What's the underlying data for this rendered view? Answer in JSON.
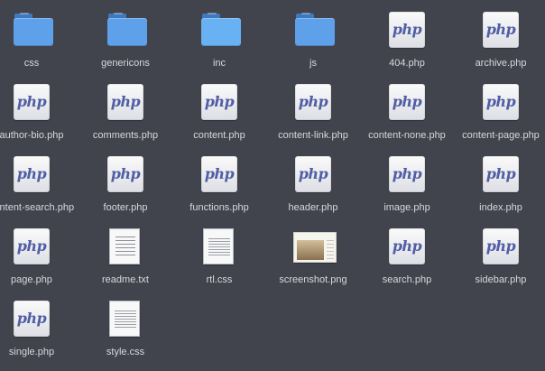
{
  "file_view": {
    "files": [
      {
        "name": "css",
        "kind": "folder",
        "icon": "folder-icon"
      },
      {
        "name": "genericons",
        "kind": "folder",
        "icon": "folder-icon"
      },
      {
        "name": "inc",
        "kind": "folder",
        "icon": "folder-icon"
      },
      {
        "name": "js",
        "kind": "folder",
        "icon": "folder-icon"
      },
      {
        "name": "404.php",
        "kind": "php",
        "icon": "php-file-icon"
      },
      {
        "name": "archive.php",
        "kind": "php",
        "icon": "php-file-icon"
      },
      {
        "name": "author-bio.php",
        "kind": "php",
        "icon": "php-file-icon"
      },
      {
        "name": "comments.php",
        "kind": "php",
        "icon": "php-file-icon"
      },
      {
        "name": "content.php",
        "kind": "php",
        "icon": "php-file-icon"
      },
      {
        "name": "content-link.php",
        "kind": "php",
        "icon": "php-file-icon"
      },
      {
        "name": "content-none.php",
        "kind": "php",
        "icon": "php-file-icon"
      },
      {
        "name": "content-page.php",
        "kind": "php",
        "icon": "php-file-icon"
      },
      {
        "name": "content-search.php",
        "kind": "php",
        "icon": "php-file-icon"
      },
      {
        "name": "footer.php",
        "kind": "php",
        "icon": "php-file-icon"
      },
      {
        "name": "functions.php",
        "kind": "php",
        "icon": "php-file-icon"
      },
      {
        "name": "header.php",
        "kind": "php",
        "icon": "php-file-icon"
      },
      {
        "name": "image.php",
        "kind": "php",
        "icon": "php-file-icon"
      },
      {
        "name": "index.php",
        "kind": "php",
        "icon": "php-file-icon"
      },
      {
        "name": "page.php",
        "kind": "php",
        "icon": "php-file-icon"
      },
      {
        "name": "readme.txt",
        "kind": "text",
        "icon": "text-document-icon"
      },
      {
        "name": "rtl.css",
        "kind": "css",
        "icon": "css-document-icon"
      },
      {
        "name": "screenshot.png",
        "kind": "image",
        "icon": "image-thumbnail-icon"
      },
      {
        "name": "search.php",
        "kind": "php",
        "icon": "php-file-icon"
      },
      {
        "name": "sidebar.php",
        "kind": "php",
        "icon": "php-file-icon"
      },
      {
        "name": "single.php",
        "kind": "php",
        "icon": "php-file-icon"
      },
      {
        "name": "style.css",
        "kind": "css",
        "icon": "css-document-icon"
      }
    ],
    "php_icon_text": "php"
  },
  "colors": {
    "background": "#41434d",
    "label": "#d8d9dd",
    "folder": "#5ea0ea",
    "php_text": "#515ea4"
  }
}
